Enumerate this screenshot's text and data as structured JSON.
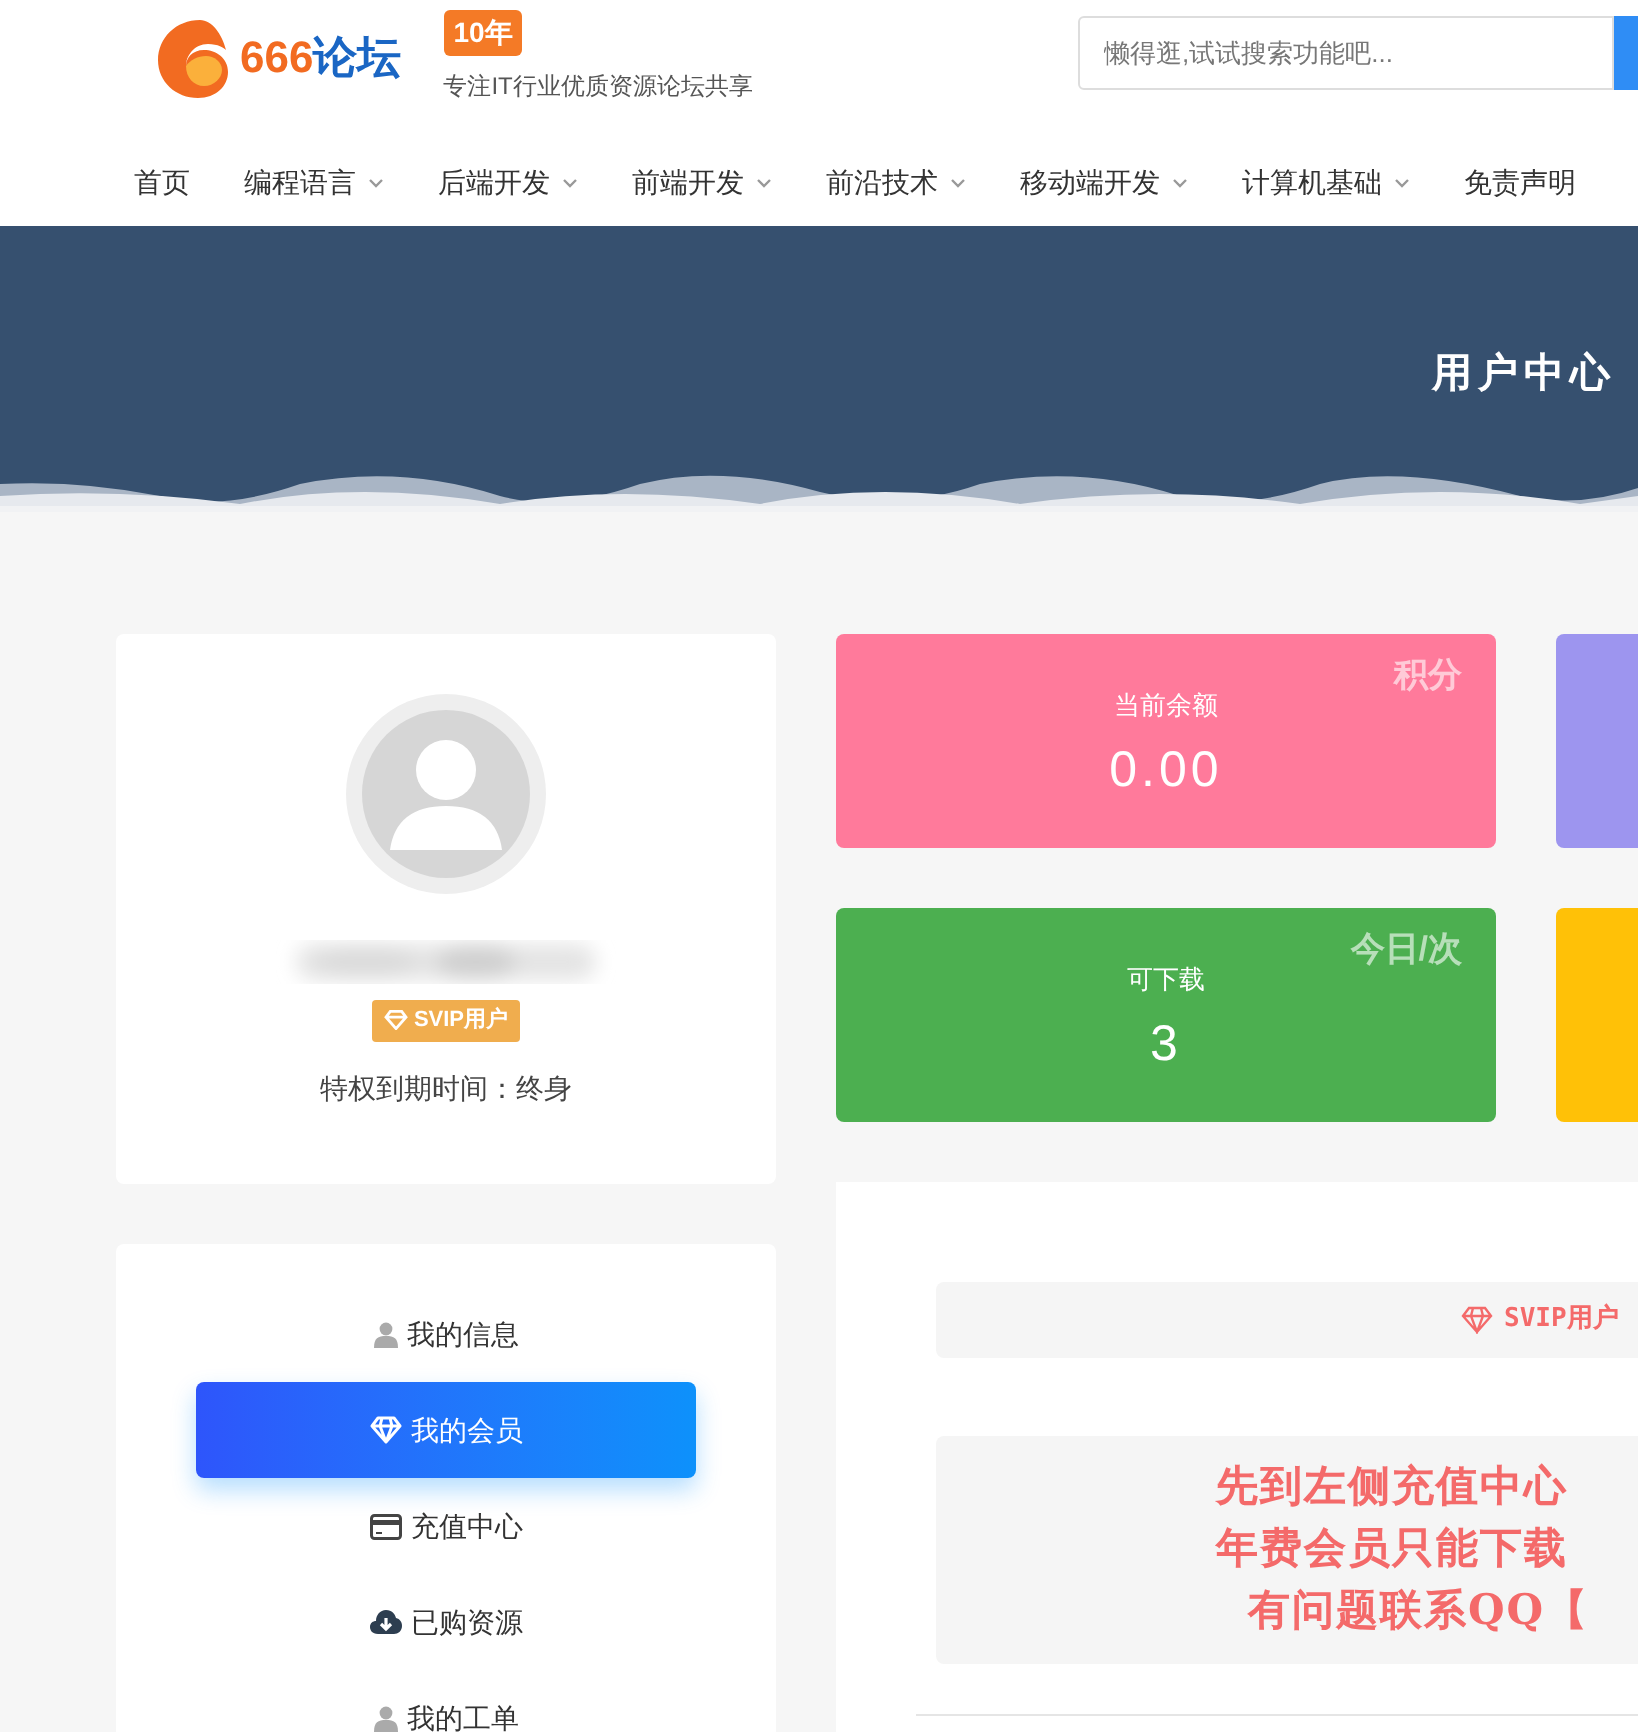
{
  "header": {
    "logo": {
      "number": "666",
      "name": "论坛"
    },
    "badge": "10年",
    "tagline": "专注IT行业优质资源论坛共享",
    "search": {
      "placeholder": "懒得逛,试试搜索功能吧..."
    }
  },
  "nav": [
    {
      "label": "首页",
      "dropdown": false
    },
    {
      "label": "编程语言",
      "dropdown": true
    },
    {
      "label": "后端开发",
      "dropdown": true
    },
    {
      "label": "前端开发",
      "dropdown": true
    },
    {
      "label": "前沿技术",
      "dropdown": true
    },
    {
      "label": "移动端开发",
      "dropdown": true
    },
    {
      "label": "计算机基础",
      "dropdown": true
    },
    {
      "label": "免责声明",
      "dropdown": false
    }
  ],
  "banner": {
    "title": "用户中心"
  },
  "profile": {
    "badge": "SVIP用户",
    "expiry": "特权到期时间：终身"
  },
  "menu": [
    {
      "label": "我的信息",
      "kind": "user",
      "selected": false
    },
    {
      "label": "我的会员",
      "kind": "diamond",
      "selected": true
    },
    {
      "label": "充值中心",
      "kind": "card",
      "selected": false
    },
    {
      "label": "已购资源",
      "kind": "download",
      "selected": false
    },
    {
      "label": "我的工单",
      "kind": "user",
      "selected": false
    }
  ],
  "stats": [
    {
      "label": "当前余额",
      "value": "0.00",
      "corner": "积分",
      "color": "#ff7a9b"
    },
    {
      "color": "#9d95ef"
    },
    {
      "label": "可下载",
      "value": "3",
      "corner": "今日/次",
      "color": "#4caf50"
    },
    {
      "color": "#ffc107"
    }
  ],
  "membership": {
    "level": "SVIP用户",
    "notice": [
      "先到左侧充值中心",
      "年费会员只能下载",
      "有问题联系QQ【"
    ]
  }
}
